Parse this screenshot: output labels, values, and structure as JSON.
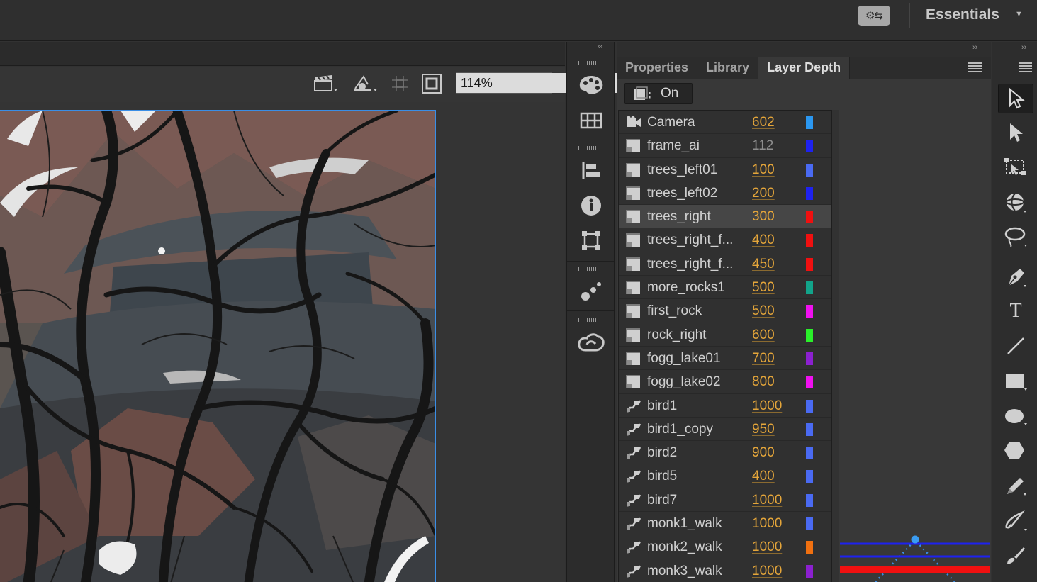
{
  "header": {
    "sync_icon": "sync-settings-icon",
    "sync_glyph": "⚙⇆",
    "workspace_label": "Essentials",
    "workspace_caret": "▼"
  },
  "stage": {
    "zoom_value": "114%",
    "zoom_dropdown": "▼",
    "toolbar_icons": [
      "clapper-board-icon",
      "transform-tool-icon",
      "snap-grid-icon",
      "clip-stage-icon"
    ]
  },
  "dock": {
    "collapse_glyph": "‹‹",
    "icons": [
      "color-swatches-icon",
      "grid-table-icon",
      "align-icon",
      "info-icon",
      "transform-box-icon",
      "motion-presets-icon",
      "creative-cloud-icon"
    ]
  },
  "panel": {
    "expand_glyph": "››",
    "tabs": [
      {
        "label": "Properties",
        "active": false
      },
      {
        "label": "Library",
        "active": false
      },
      {
        "label": "Layer Depth",
        "active": true
      }
    ],
    "toggle_label": "On",
    "layers": [
      {
        "name": "Camera",
        "depth": "602",
        "color": "#2b97f0",
        "icon": "camera-icon",
        "selected": false,
        "dim": false
      },
      {
        "name": "frame_ai",
        "depth": "112",
        "color": "#1e22f0",
        "icon": "layer-icon",
        "selected": false,
        "dim": true
      },
      {
        "name": "trees_left01",
        "depth": "100",
        "color": "#4a6af2",
        "icon": "layer-icon",
        "selected": false,
        "dim": false
      },
      {
        "name": "trees_left02",
        "depth": "200",
        "color": "#1e22f0",
        "icon": "layer-icon",
        "selected": false,
        "dim": false
      },
      {
        "name": "trees_right",
        "depth": "300",
        "color": "#f01010",
        "icon": "layer-icon",
        "selected": true,
        "dim": false
      },
      {
        "name": "trees_right_f...",
        "depth": "400",
        "color": "#f01010",
        "icon": "layer-icon",
        "selected": false,
        "dim": false
      },
      {
        "name": "trees_right_f...",
        "depth": "450",
        "color": "#f01010",
        "icon": "layer-icon",
        "selected": false,
        "dim": false
      },
      {
        "name": "more_rocks1",
        "depth": "500",
        "color": "#12a48a",
        "icon": "layer-icon",
        "selected": false,
        "dim": false
      },
      {
        "name": "first_rock",
        "depth": "500",
        "color": "#f010f0",
        "icon": "layer-icon",
        "selected": false,
        "dim": false
      },
      {
        "name": "rock_right",
        "depth": "600",
        "color": "#2af02a",
        "icon": "layer-icon",
        "selected": false,
        "dim": false
      },
      {
        "name": "fogg_lake01",
        "depth": "700",
        "color": "#8c20d0",
        "icon": "layer-icon",
        "selected": false,
        "dim": false
      },
      {
        "name": "fogg_lake02",
        "depth": "800",
        "color": "#f010f0",
        "icon": "layer-icon",
        "selected": false,
        "dim": false
      },
      {
        "name": "bird1",
        "depth": "1000",
        "color": "#4a6af2",
        "icon": "motion-layer-icon",
        "selected": false,
        "dim": false
      },
      {
        "name": "bird1_copy",
        "depth": "950",
        "color": "#4a6af2",
        "icon": "motion-layer-icon",
        "selected": false,
        "dim": false
      },
      {
        "name": "bird2",
        "depth": "900",
        "color": "#4a6af2",
        "icon": "motion-layer-icon",
        "selected": false,
        "dim": false
      },
      {
        "name": "bird5",
        "depth": "400",
        "color": "#4a6af2",
        "icon": "motion-layer-icon",
        "selected": false,
        "dim": false
      },
      {
        "name": "bird7",
        "depth": "1000",
        "color": "#4a6af2",
        "icon": "motion-layer-icon",
        "selected": false,
        "dim": false
      },
      {
        "name": "monk1_walk",
        "depth": "1000",
        "color": "#4a6af2",
        "icon": "motion-layer-icon",
        "selected": false,
        "dim": false
      },
      {
        "name": "monk2_walk",
        "depth": "1000",
        "color": "#f07010",
        "icon": "motion-layer-icon",
        "selected": false,
        "dim": false
      },
      {
        "name": "monk3_walk",
        "depth": "1000",
        "color": "#8c20d0",
        "icon": "motion-layer-icon",
        "selected": false,
        "dim": false
      }
    ]
  },
  "tools": {
    "expand_glyph": "››",
    "text_tool_glyph": "T",
    "items": [
      "selection-tool-icon",
      "subselection-tool-icon",
      "free-transform-tool-icon",
      "3d-rotation-tool-icon",
      "lasso-tool-icon",
      "pen-tool-icon",
      "text-tool-icon",
      "line-tool-icon",
      "rectangle-tool-icon",
      "oval-tool-icon",
      "polystar-tool-icon",
      "pencil-tool-icon",
      "paint-brush-tool-icon",
      "brush-tool-icon"
    ]
  }
}
